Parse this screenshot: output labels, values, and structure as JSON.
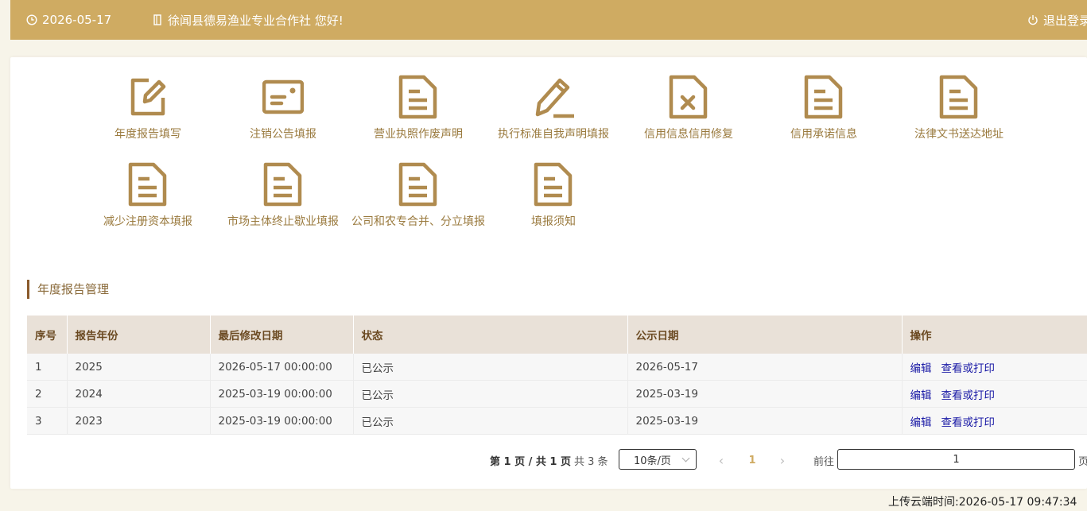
{
  "header": {
    "date": "2026-05-17",
    "welcome": "徐闻县德易渔业专业合作社 您好!",
    "logout": "退出登录",
    "bg_color": "#cfab62"
  },
  "functions": [
    {
      "label": "年度报告填写",
      "icon": "edit-icon"
    },
    {
      "label": "注销公告填报",
      "icon": "id-card-icon"
    },
    {
      "label": "营业执照作废声明",
      "icon": "document-icon"
    },
    {
      "label": "执行标准自我声明填报",
      "icon": "pencil-icon"
    },
    {
      "label": "信用信息信用修复",
      "icon": "document-x-icon"
    },
    {
      "label": "信用承诺信息",
      "icon": "document-icon"
    },
    {
      "label": "法律文书送达地址",
      "icon": "document-icon"
    },
    {
      "label": "减少注册资本填报",
      "icon": "document-icon"
    },
    {
      "label": "市场主体终止歇业填报",
      "icon": "document-icon"
    },
    {
      "label": "公司和农专合并、分立填报",
      "icon": "document-icon"
    },
    {
      "label": "填报须知",
      "icon": "document-icon"
    }
  ],
  "section": {
    "title": "年度报告管理"
  },
  "table": {
    "columns": [
      "序号",
      "报告年份",
      "最后修改日期",
      "状态",
      "公示日期",
      "操作"
    ],
    "rows": [
      {
        "no": "1",
        "year": "2025",
        "modified": "2026-05-17 00:00:00",
        "status": "已公示",
        "publish": "2026-05-17",
        "edit": "编辑",
        "view": "查看或打印"
      },
      {
        "no": "2",
        "year": "2024",
        "modified": "2025-03-19 00:00:00",
        "status": "已公示",
        "publish": "2025-03-19",
        "edit": "编辑",
        "view": "查看或打印"
      },
      {
        "no": "3",
        "year": "2023",
        "modified": "2025-03-19 00:00:00",
        "status": "已公示",
        "publish": "2025-03-19",
        "edit": "编辑",
        "view": "查看或打印"
      }
    ]
  },
  "pagination": {
    "info": "第 1 页 / 共 1 页",
    "total": "共 3 条",
    "page_size": "10条/页",
    "prev": "‹",
    "current": "1",
    "next": "›",
    "goto_label": "前往",
    "goto_value": "1",
    "page_suffix": "页"
  },
  "footer": {
    "upload_time": "上传云端时间:2026-05-17 09:47:34"
  },
  "colors": {
    "accent": "#cfab62",
    "icon": "#b08b4f",
    "label": "#9a7a3e",
    "link": "#1a1aa6"
  }
}
